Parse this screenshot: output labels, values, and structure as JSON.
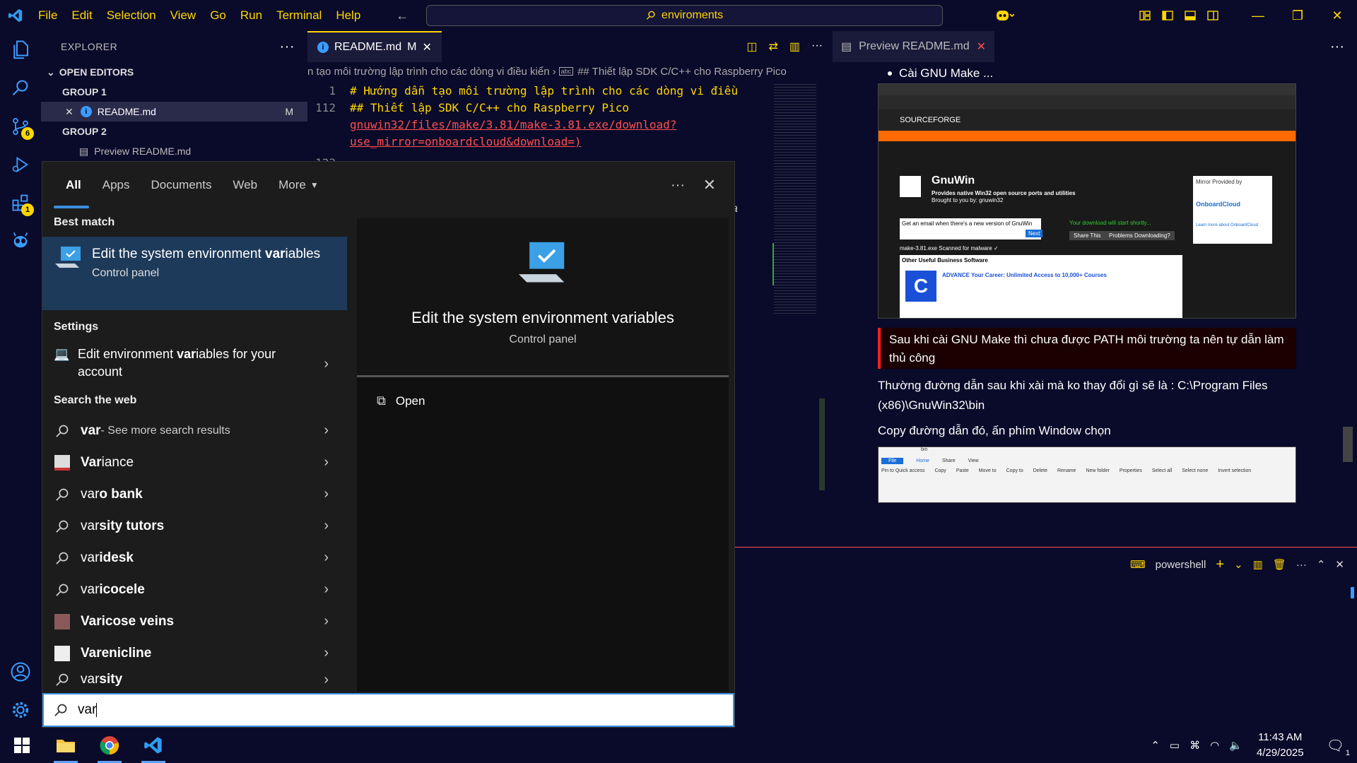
{
  "titlebar": {
    "menu": [
      "File",
      "Edit",
      "Selection",
      "View",
      "Go",
      "Run",
      "Terminal",
      "Help"
    ],
    "command_center": "enviroments"
  },
  "activitybar": {
    "source_control_badge": "6",
    "extensions_badge": "1"
  },
  "sidebar": {
    "title": "EXPLORER",
    "open_editors": "OPEN EDITORS",
    "group1": "GROUP 1",
    "file1": "README.md",
    "file1_status": "M",
    "group2": "GROUP 2",
    "file2": "Preview README.md"
  },
  "editor": {
    "tab_label": "README.md",
    "tab_status": "M",
    "breadcrumb_left": "n tạo môi trường lập trình cho các dòng vi điều kiển",
    "breadcrumb_right": "## Thiết lập SDK C/C++ cho Raspberry Pico",
    "lines": [
      {
        "num": "1",
        "text": "# Hướng dẫn tạo môi trường lập trình cho các dòng vi điều"
      },
      {
        "num": "112",
        "text": "## Thiết lập SDK C/C++ cho Raspberry Pico"
      },
      {
        "num": "",
        "text": "gnuwin32/files/make/3.81/make-3.81.exe/download?"
      },
      {
        "num": "",
        "text": "use_mirror=onboardcloud&download=)"
      },
      {
        "num": "123",
        "text": ""
      }
    ],
    "italic_fragment": "a"
  },
  "preview": {
    "tab_label": "Preview README.md",
    "bullet": "Cài GNU Make ...",
    "screenshot1": {
      "brand": "SOURCEFORGE",
      "project": "GnuWin",
      "tagline": "Provides native Win32 open source ports and utilities",
      "brought_by": "Brought to you by: gnuwin32",
      "email_prompt": "Get an email when there's a new version of GnuWin",
      "notify": "Next",
      "download_msg": "Your download will start shortly...",
      "share": "Share This",
      "problems": "Problems Downloading?",
      "mirror_label": "Mirror Provided by",
      "mirror": "OnboardCloud",
      "learn_more": "Learn more about OnboardCloud",
      "file_row": "make-3.81.exe   Scanned for malware ✓",
      "other_title": "Other Useful Business Software",
      "ad_title": "ADVANCE Your Career: Unlimited Access to 10,000+ Courses"
    },
    "callout": "Sau khi cài GNU Make thì chưa được PATH môi trường ta nên tự dẫn làm thủ công",
    "para1": "Thường đường dẫn sau khi xài mà ko thay đổi gì sẽ là : C:\\Program Files (x86)\\GnuWin32\\bin",
    "para2": "Copy đường dẫn đó, ấn phím Window chọn",
    "screenshot2": {
      "title": "bin",
      "tabs": [
        "File",
        "Home",
        "Share",
        "View"
      ],
      "tools": [
        "Pin to Quick access",
        "Copy",
        "Paste",
        "Move to",
        "Copy to",
        "Delete",
        "Rename",
        "New folder",
        "Properties",
        "Select all",
        "Select none",
        "Invert selection"
      ]
    }
  },
  "panel": {
    "terminal_label": "powershell"
  },
  "search": {
    "tabs": [
      "All",
      "Apps",
      "Documents",
      "Web",
      "More"
    ],
    "best_match_label": "Best match",
    "best_title_a": "Edit the system environment ",
    "best_title_b": "var",
    "best_title_c": "iables",
    "best_sub": "Control panel",
    "settings_label": "Settings",
    "setting_a": "Edit environment ",
    "setting_b": "var",
    "setting_c": "iables for your account",
    "web_label": "Search the web",
    "web_first_bold": "var",
    "web_first_rest": " - See more search results",
    "web_items": [
      {
        "bold": "Var",
        "rest": "iance",
        "icon": "image"
      },
      {
        "bold": "var",
        "rest": "o bank",
        "icon": "search"
      },
      {
        "bold": "var",
        "rest": "sity tutors",
        "icon": "search"
      },
      {
        "bold": "var",
        "rest": "idesk",
        "icon": "search"
      },
      {
        "bold": "var",
        "rest": "icocele",
        "icon": "search"
      },
      {
        "bold": "Var",
        "rest": "icose veins",
        "icon": "image"
      },
      {
        "bold": "Var",
        "rest": "enicline",
        "icon": "image"
      },
      {
        "bold": "var",
        "rest": "sity",
        "icon": "search"
      }
    ],
    "detail_title": "Edit the system environment variables",
    "detail_sub": "Control panel",
    "open_label": "Open",
    "query": "var"
  },
  "taskbar": {
    "time": "11:43 AM",
    "date": "4/29/2025",
    "notif_count": "1"
  }
}
